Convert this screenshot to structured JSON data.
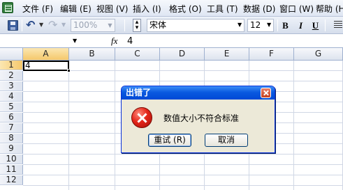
{
  "menu": [
    "文件 (F)",
    "编辑 (E)",
    "视图 (V)",
    "插入 (I)",
    "格式 (O)",
    "工具 (T)",
    "数据 (D)",
    "窗口 (W)",
    "帮助 (H)"
  ],
  "toolbar": {
    "zoom": "100%",
    "font_name": "宋体",
    "font_size": "12",
    "bold": "B",
    "italic": "I",
    "underline": "U"
  },
  "formula_bar": {
    "name_box": "",
    "fx_label": "fx",
    "value": "4"
  },
  "grid": {
    "columns": [
      "A",
      "B",
      "C",
      "D",
      "E",
      "F",
      "G"
    ],
    "rows": [
      "1",
      "2",
      "3",
      "4",
      "5",
      "6",
      "7",
      "8",
      "9",
      "10",
      "11",
      "12"
    ],
    "active_cell": "A1",
    "cells": {
      "A1": "4"
    }
  },
  "dialog": {
    "title": "出错了",
    "message": "数值大小不符合标准",
    "retry_label": "重试 (R)",
    "cancel_label": "取消",
    "icon": "error-icon"
  }
}
